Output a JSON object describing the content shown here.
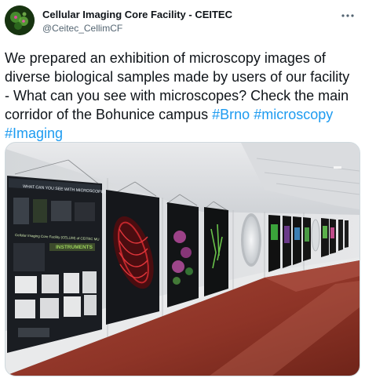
{
  "author": {
    "name": "Cellular Imaging Core Facility - CEITEC",
    "handle": "@Ceitec_CellimCF",
    "avatar_icon": "microscopy-cells-avatar"
  },
  "menu": {
    "more_icon": "more-dots-icon",
    "more_label": "···"
  },
  "tweet": {
    "text_before": "We prepared an exhibition of microscopy images of diverse biological samples made by users of our facility - What can you see with microscopes? Check the main corridor of the Bohunice campus ",
    "hashtags": [
      "#Brno",
      "#microscopy",
      "#Imaging"
    ]
  },
  "media": {
    "type": "photo",
    "poster_heading": "WHAT CAN YOU SEE WITH MICROSCOPES?",
    "poster_title": "Cellular Imaging Core Facility (CELLIM) of CEITEC MU",
    "poster_section": "INSTRUMENTS"
  },
  "colors": {
    "accent": "#1d9bf0",
    "text": "#0f1419",
    "muted": "#536471",
    "border": "#cfd9de"
  }
}
